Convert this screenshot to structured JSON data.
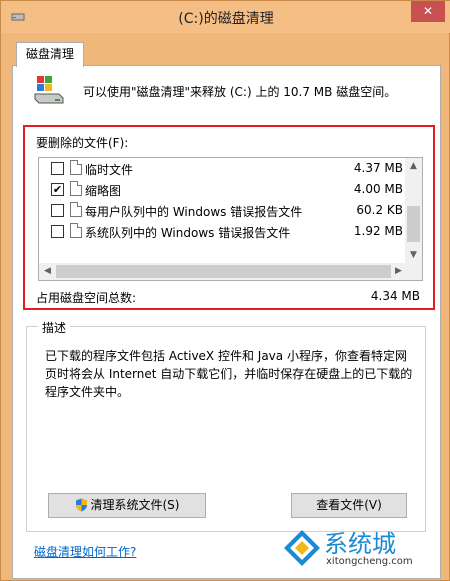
{
  "window": {
    "title": "(C:)的磁盘清理",
    "close_glyph": "✕"
  },
  "tab": {
    "label": "磁盘清理"
  },
  "info": {
    "text": "可以使用\"磁盘清理\"来释放 (C:) 上的 10.7 MB 磁盘空间。"
  },
  "files_section": {
    "label": "要删除的文件(F):",
    "items": [
      {
        "name": "临时文件",
        "size": "4.37 MB",
        "checked": false,
        "check_glyph": ""
      },
      {
        "name": "缩略图",
        "size": "4.00 MB",
        "checked": true,
        "check_glyph": "✔"
      },
      {
        "name": "每用户队列中的 Windows 错误报告文件",
        "size": "60.2 KB",
        "checked": false,
        "check_glyph": ""
      },
      {
        "name": "系统队列中的 Windows 错误报告文件",
        "size": "1.92 MB",
        "checked": false,
        "check_glyph": ""
      }
    ],
    "total_label": "占用磁盘空间总数:",
    "total_value": "4.34 MB"
  },
  "description": {
    "label": "描述",
    "text": "已下载的程序文件包括 ActiveX 控件和 Java 小程序，你查看特定网页时将会从 Internet 自动下载它们，并临时保存在硬盘上的已下载的程序文件夹中。"
  },
  "buttons": {
    "clean_system": "清理系统文件(S)",
    "view_files": "查看文件(V)"
  },
  "help_link": "磁盘清理如何工作?",
  "watermark": {
    "brand": "系统城",
    "url": "xitongcheng.com"
  },
  "colors": {
    "highlight": "#e02020",
    "link": "#0066cc",
    "close": "#c75050"
  },
  "icons": {
    "window": "disk-cleanup-icon",
    "drive": "drive-icon",
    "file": "document-icon",
    "shield": "uac-shield-icon"
  }
}
